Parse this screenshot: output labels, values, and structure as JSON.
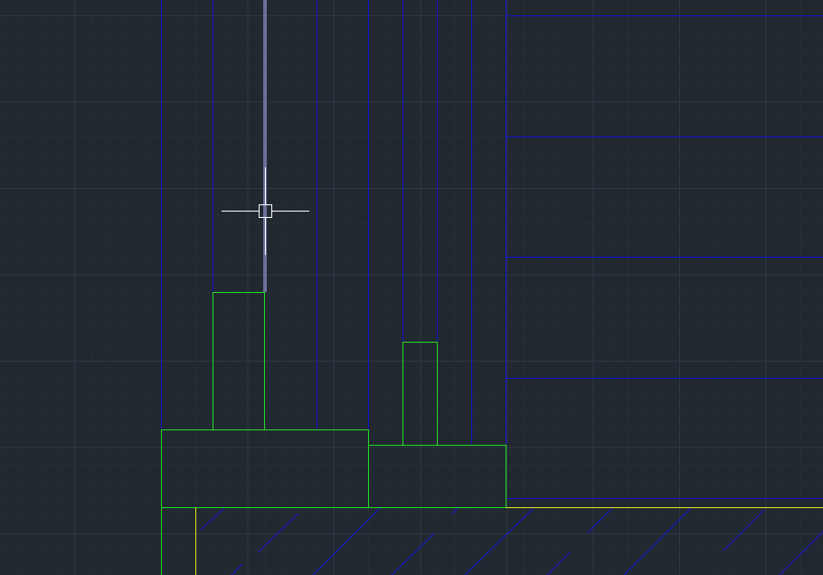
{
  "app": {
    "view": "cad-drawing-viewport",
    "background_color": "#212830"
  },
  "colors": {
    "grid_major": "#2f3945",
    "grid_minor": "#262d36",
    "blue_layer": "#1010cc",
    "green_layer": "#22dd22",
    "yellow_layer": "#e6e62a",
    "hatch": "#1818d8",
    "selected_line": "#6c6f99",
    "crosshair": "#ffffff"
  },
  "cursor": {
    "type": "crosshair-with-pickbox",
    "icon": "crosshair-cursor-icon"
  }
}
